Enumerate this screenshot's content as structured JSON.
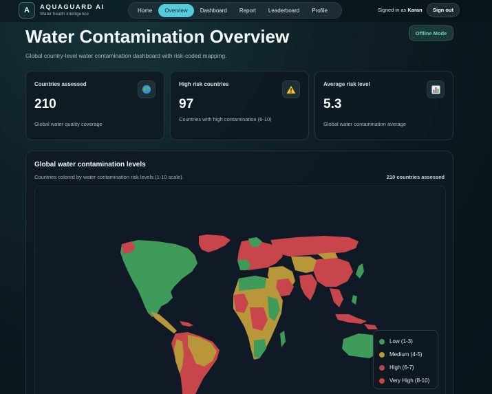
{
  "brand": {
    "logo_letter": "A",
    "name": "AQUAGUARD AI",
    "tagline": "Water health intelligence"
  },
  "nav": {
    "items": [
      {
        "label": "Home",
        "active": false
      },
      {
        "label": "Overview",
        "active": true
      },
      {
        "label": "Dashboard",
        "active": false
      },
      {
        "label": "Report",
        "active": false
      },
      {
        "label": "Leaderboard",
        "active": false
      },
      {
        "label": "Profile",
        "active": false
      }
    ]
  },
  "user": {
    "signed_in_prefix": "Signed in as",
    "name": "Karan",
    "signout_label": "Sign out"
  },
  "page": {
    "title": "Water Contamination Overview",
    "subtitle": "Global country-level water contamination dashboard with risk-coded mapping.",
    "offline_label": "Offline Mode"
  },
  "stats": [
    {
      "label": "Countries assessed",
      "value": "210",
      "desc": "Global water quality coverage",
      "icon": "globe-icon"
    },
    {
      "label": "High risk countries",
      "value": "97",
      "desc": "Countries with high contamination (6-10)",
      "icon": "warning-icon"
    },
    {
      "label": "Average risk level",
      "value": "5.3",
      "desc": "Global water contamination average",
      "icon": "bar-chart-icon"
    }
  ],
  "map": {
    "title": "Global water contamination levels",
    "subtitle": "Countries colored by water contamination risk levels (1-10 scale).",
    "count": "210 countries assessed",
    "legend": [
      {
        "label": "Low (1-3)",
        "color": "#3f9b5a"
      },
      {
        "label": "Medium (4-5)",
        "color": "#b8963a"
      },
      {
        "label": "High (6-7)",
        "color": "#b5474e"
      },
      {
        "label": "Very High (8-10)",
        "color": "#c8454b"
      }
    ]
  }
}
